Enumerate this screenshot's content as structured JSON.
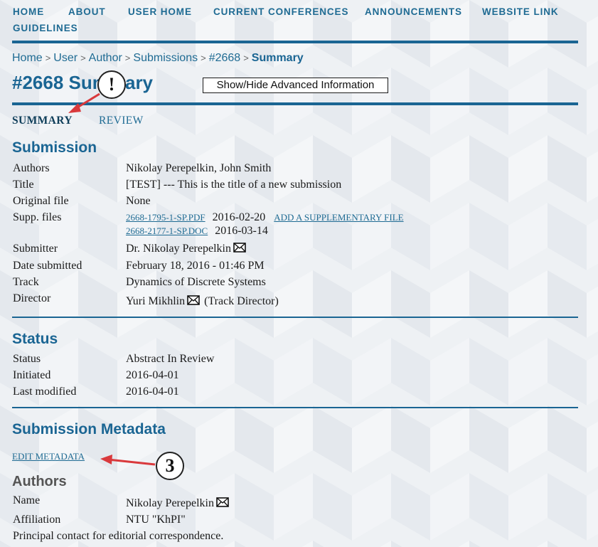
{
  "nav": {
    "items": [
      "HOME",
      "ABOUT",
      "USER HOME",
      "CURRENT CONFERENCES",
      "ANNOUNCEMENTS",
      "WEBSITE LINK",
      "GUIDELINES"
    ]
  },
  "breadcrumb": {
    "items": [
      "Home",
      "User",
      "Author",
      "Submissions",
      "#2668"
    ],
    "current": "Summary",
    "separator": ">"
  },
  "header": {
    "title": "#2668 Summary",
    "advanced_button": "Show/Hide Advanced Information"
  },
  "tabs": {
    "summary": "SUMMARY",
    "review": "REVIEW"
  },
  "submission": {
    "heading": "Submission",
    "authors_label": "Authors",
    "authors": "Nikolay Perepelkin, John Smith",
    "title_label": "Title",
    "title": "[TEST] --- This is the title of a new submission",
    "original_label": "Original file",
    "original": "None",
    "supp_label": "Supp. files",
    "supp_files": [
      {
        "name": "2668-1795-1-SP.PDF",
        "date": "2016-02-20"
      },
      {
        "name": "2668-2177-1-SP.DOC",
        "date": "2016-03-14"
      }
    ],
    "add_supp": "ADD A SUPPLEMENTARY FILE",
    "submitter_label": "Submitter",
    "submitter": "Dr. Nikolay Perepelkin",
    "date_label": "Date submitted",
    "date": "February 18, 2016 - 01:46 PM",
    "track_label": "Track",
    "track": "Dynamics of Discrete Systems",
    "director_label": "Director",
    "director": "Yuri Mikhlin",
    "director_role": "(Track Director)"
  },
  "status": {
    "heading": "Status",
    "status_label": "Status",
    "status": "Abstract In Review",
    "initiated_label": "Initiated",
    "initiated": "2016-04-01",
    "modified_label": "Last modified",
    "modified": "2016-04-01"
  },
  "metadata": {
    "heading": "Submission Metadata",
    "edit_link": "EDIT METADATA",
    "authors_heading": "Authors",
    "name_label": "Name",
    "name": "Nikolay Perepelkin",
    "affiliation_label": "Affiliation",
    "affiliation": "NTU \"KhPI\"",
    "note": "Principal contact for editorial correspondence."
  },
  "annotations": {
    "callout_1": "!",
    "callout_2": "3"
  },
  "colors": {
    "accent": "#1a6593",
    "link": "#1f6b93",
    "arrow": "#d9393c"
  },
  "icons": [
    "envelope-icon",
    "arrow-icon"
  ]
}
